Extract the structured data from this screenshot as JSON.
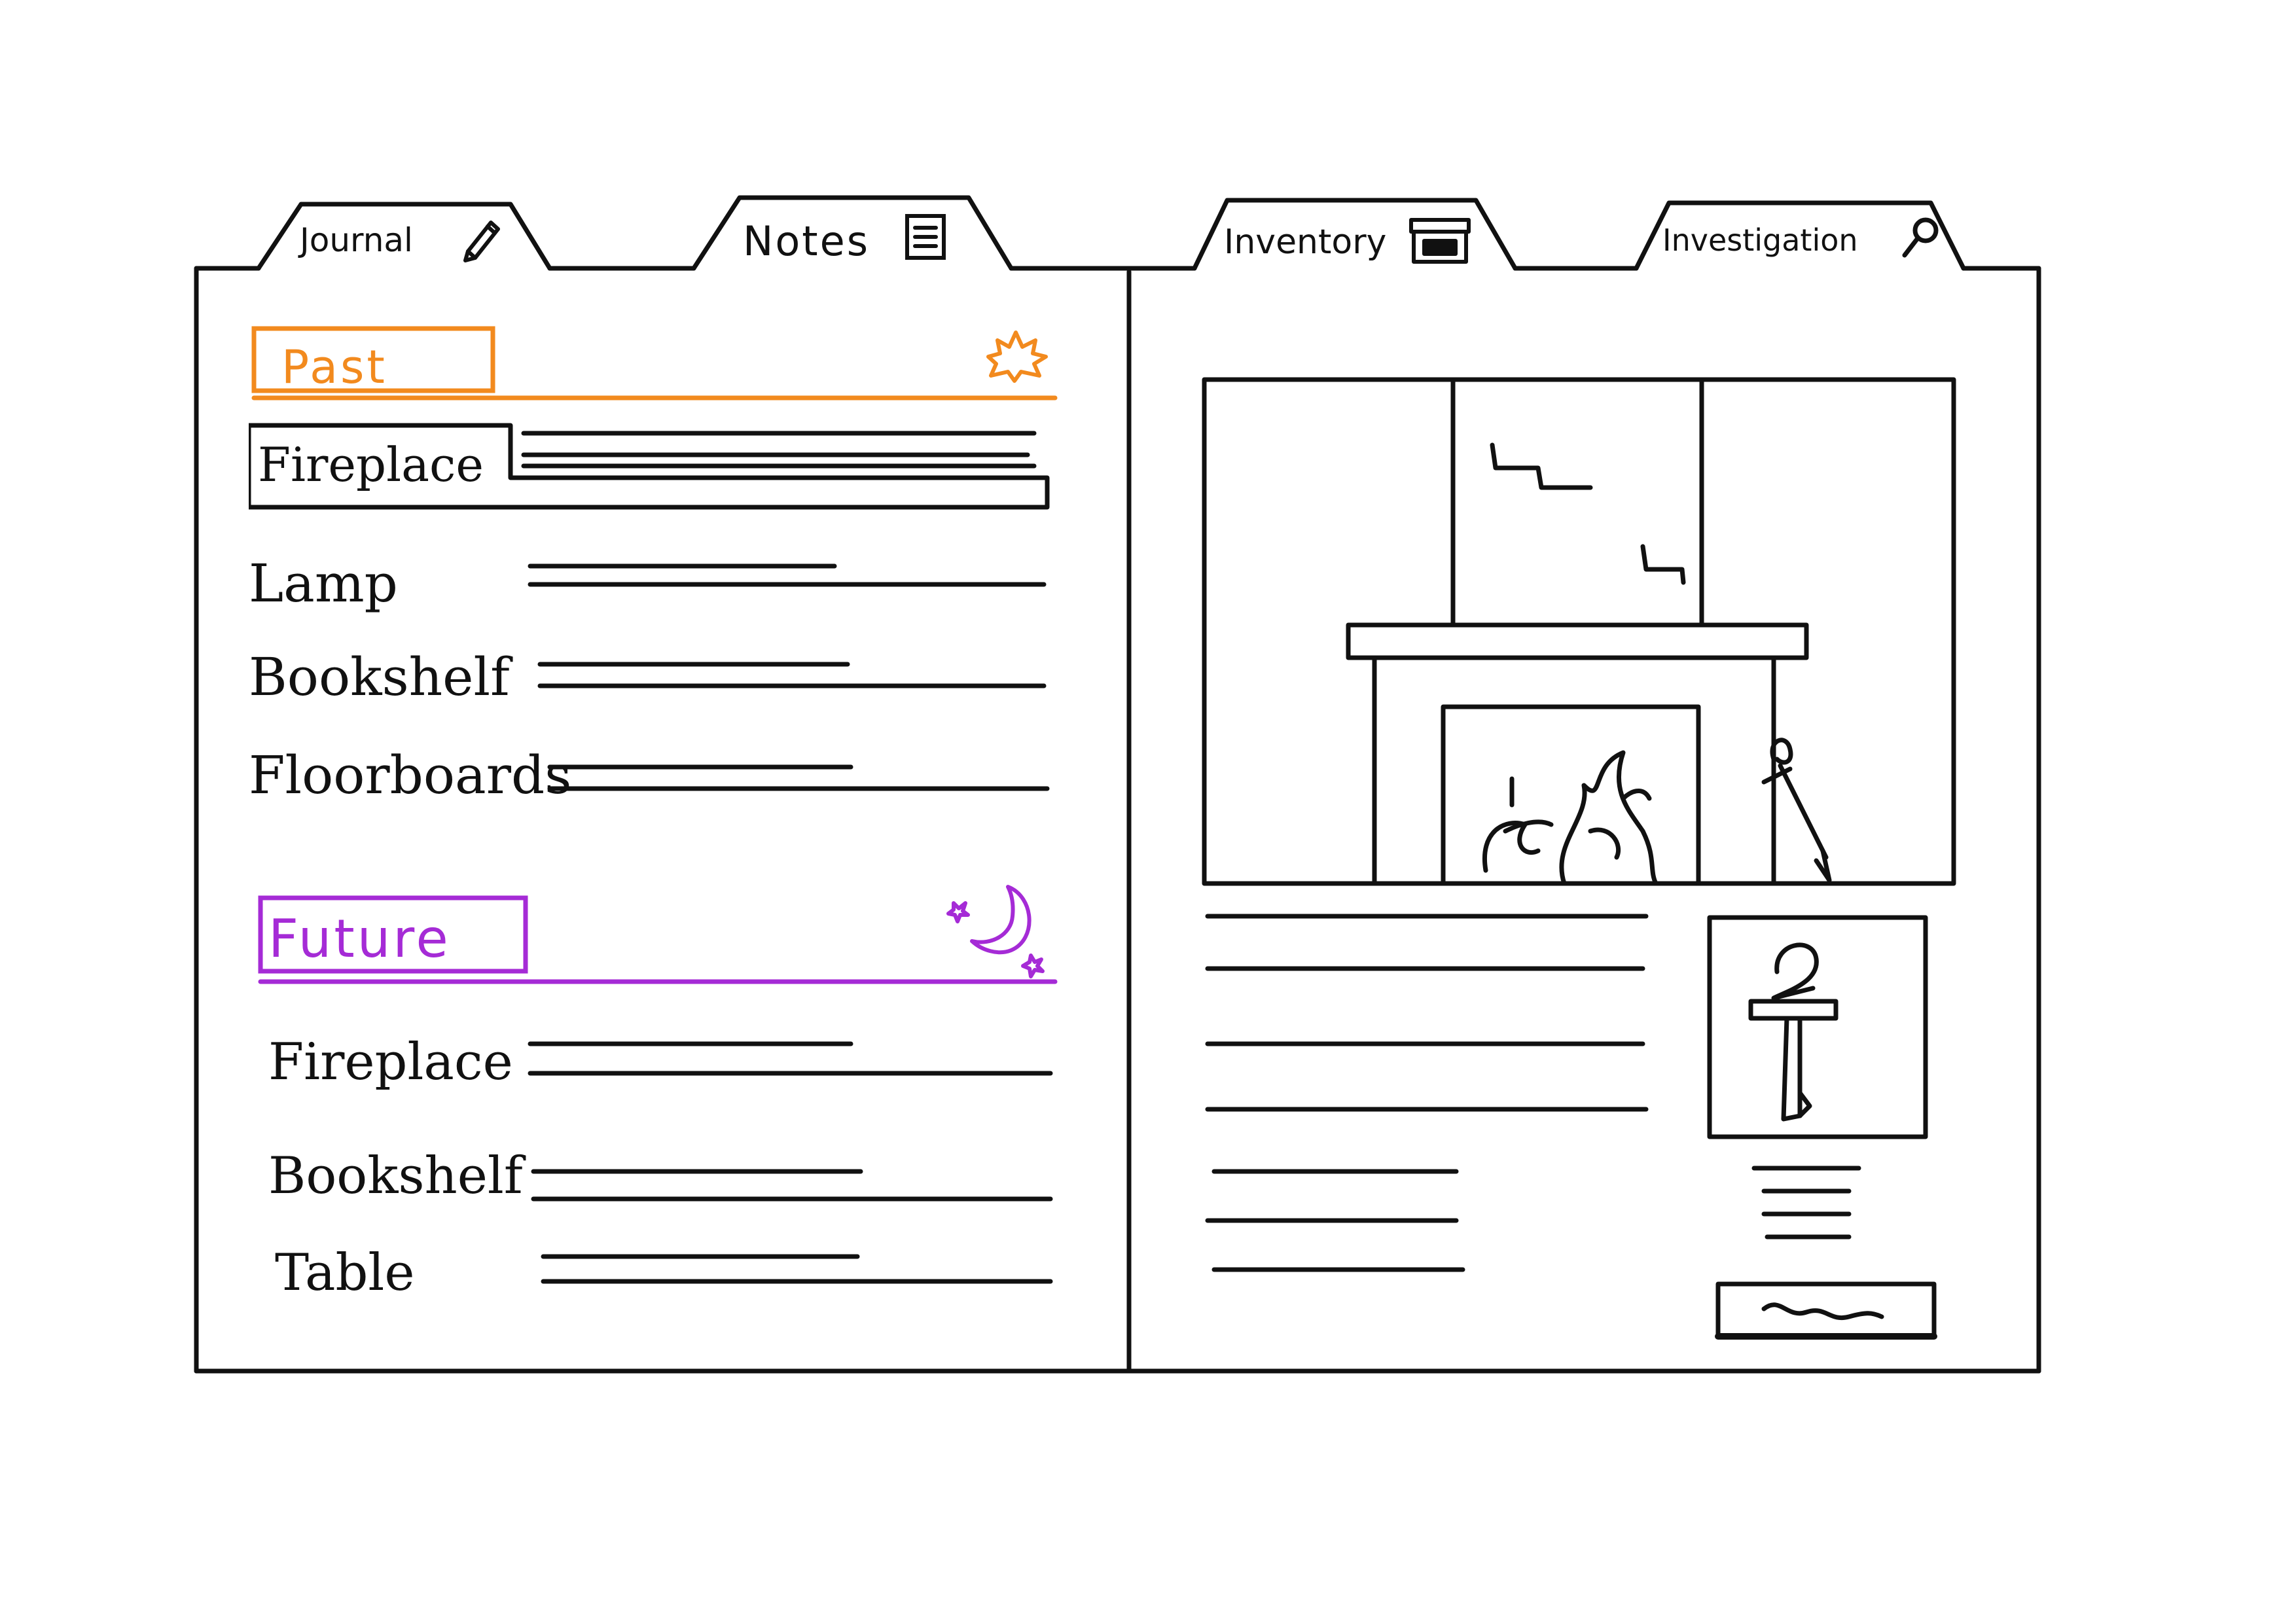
{
  "tabs": [
    {
      "label": "Journal",
      "icon": "pencil-icon",
      "active": true
    },
    {
      "label": "Notes",
      "icon": "notes-icon",
      "active": false
    },
    {
      "label": "Inventory",
      "icon": "chest-icon",
      "active": false
    },
    {
      "label": "Investigation",
      "icon": "magnifier-icon",
      "active": false
    }
  ],
  "journal": {
    "past": {
      "label": "Past",
      "color": "#f28a1e",
      "icon": "sun-icon",
      "entries": [
        "Fireplace",
        "Lamp",
        "Bookshelf",
        "Floorboards"
      ]
    },
    "future": {
      "label": "Future",
      "color": "#a52bd6",
      "icon": "moon-stars-icon",
      "entries": [
        "Fireplace",
        "Bookshelf",
        "Table"
      ]
    }
  },
  "detail": {
    "scene": "fireplace-illustration",
    "item_icon": "poker-icon"
  },
  "colors": {
    "ink": "#111111",
    "past": "#f28a1e",
    "future": "#a52bd6"
  }
}
